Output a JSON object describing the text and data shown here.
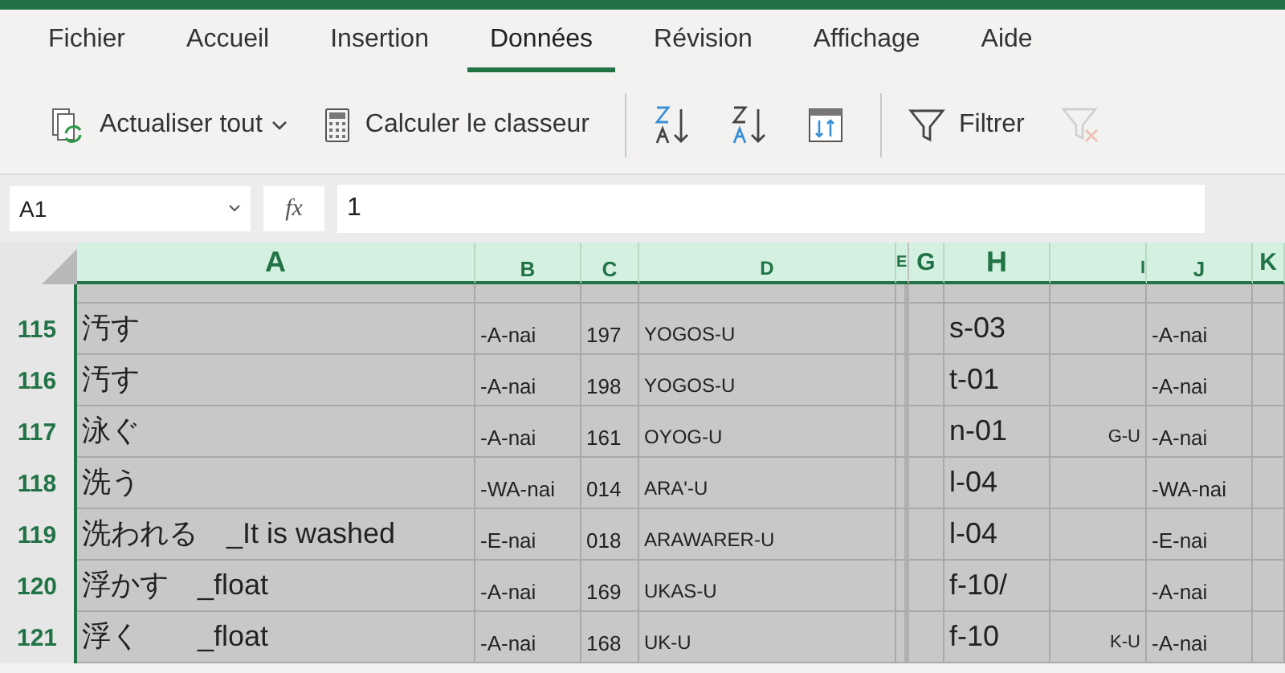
{
  "ribbon_tabs": [
    {
      "label": "Fichier",
      "selected": false
    },
    {
      "label": "Accueil",
      "selected": false
    },
    {
      "label": "Insertion",
      "selected": false
    },
    {
      "label": "Données",
      "selected": true
    },
    {
      "label": "Révision",
      "selected": false
    },
    {
      "label": "Affichage",
      "selected": false
    },
    {
      "label": "Aide",
      "selected": false
    }
  ],
  "toolbar": [
    {
      "kind": "refresh",
      "label": "Actualiser tout",
      "dropdown": true,
      "disabled": false
    },
    {
      "kind": "calculate",
      "label": "Calculer le classeur",
      "dropdown": false,
      "disabled": false
    },
    {
      "kind": "separator"
    },
    {
      "kind": "sort-ascending",
      "disabled": false
    },
    {
      "kind": "sort-descending",
      "disabled": false
    },
    {
      "kind": "sort-custom",
      "disabled": false
    },
    {
      "kind": "separator"
    },
    {
      "kind": "filter",
      "label": "Filtrer",
      "disabled": false
    },
    {
      "kind": "clear-filter",
      "disabled": true
    }
  ],
  "formula_bar": {
    "name_box": "A1",
    "function_label": "fx",
    "value": "1"
  },
  "columns": [
    {
      "label": "A"
    },
    {
      "label": "B"
    },
    {
      "label": "C"
    },
    {
      "label": "D"
    },
    {
      "label": "E"
    },
    {
      "label": "G"
    },
    {
      "label": "H"
    },
    {
      "label": "I"
    },
    {
      "label": "J"
    },
    {
      "label": "K"
    }
  ],
  "rows": [
    {
      "number": "115",
      "cells": {
        "a": "汚す",
        "b": "-A-nai",
        "c": "197",
        "d": "YOGOS-U",
        "h": "s-03",
        "j": "-A-nai"
      }
    },
    {
      "number": "116",
      "cells": {
        "a": "汚す",
        "b": "-A-nai",
        "c": "198",
        "d": "YOGOS-U",
        "h": "t-01",
        "j": "-A-nai"
      }
    },
    {
      "number": "117",
      "cells": {
        "a": "泳ぐ",
        "b": "-A-nai",
        "c": "161",
        "d": "OYOG-U",
        "h": "n-01",
        "i": "G-U",
        "j": "-A-nai"
      }
    },
    {
      "number": "118",
      "cells": {
        "a": "洗う",
        "b": "-WA-nai",
        "c": "014",
        "d": "ARA'-U",
        "h": "l-04",
        "j": "-WA-nai"
      }
    },
    {
      "number": "119",
      "cells": {
        "a": "洗われる　_It is washed",
        "b": "-E-nai",
        "c": "018",
        "d": "ARAWARER-U",
        "h": "l-04",
        "j": "-E-nai"
      }
    },
    {
      "number": "120",
      "cells": {
        "a": "浮かす　_float",
        "b": "-A-nai",
        "c": "169",
        "d": "UKAS-U",
        "h": "f-10/",
        "j": "-A-nai"
      }
    },
    {
      "number": "121",
      "cells": {
        "a": "浮く　　_float",
        "b": "-A-nai",
        "c": "168",
        "d": "UK-U",
        "h": "f-10",
        "i": "K-U",
        "j": "-A-nai"
      }
    }
  ]
}
